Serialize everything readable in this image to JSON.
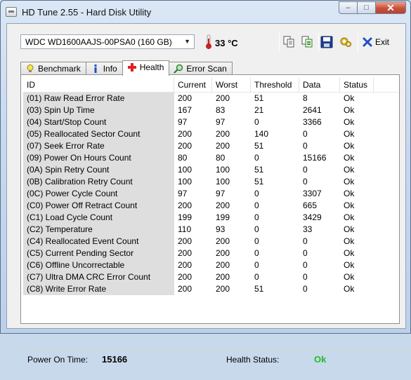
{
  "window": {
    "title": "HD Tune 2.55 - Hard Disk Utility",
    "buttons": {
      "minimize": "–",
      "maximize": "□",
      "close": "✕"
    }
  },
  "toolbar": {
    "drive": "WDC WD1600AAJS-00PSA0 (160 GB)",
    "temperature": "33 °C",
    "exit_label": "Exit",
    "icons": [
      "copy-icon",
      "copy-all-icon",
      "save-icon",
      "options-icon",
      "exit-icon"
    ]
  },
  "tabs": [
    {
      "label": "Benchmark",
      "icon": "lightbulb-icon",
      "active": false
    },
    {
      "label": "Info",
      "icon": "info-icon",
      "active": false
    },
    {
      "label": "Health",
      "icon": "health-cross-icon",
      "active": true
    },
    {
      "label": "Error Scan",
      "icon": "magnifier-icon",
      "active": false
    }
  ],
  "table": {
    "headers": [
      "ID",
      "Current",
      "Worst",
      "Threshold",
      "Data",
      "Status"
    ],
    "rows": [
      [
        "(01) Raw Read Error Rate",
        "200",
        "200",
        "51",
        "8",
        "Ok"
      ],
      [
        "(03) Spin Up Time",
        "167",
        "83",
        "21",
        "2641",
        "Ok"
      ],
      [
        "(04) Start/Stop Count",
        "97",
        "97",
        "0",
        "3366",
        "Ok"
      ],
      [
        "(05) Reallocated Sector Count",
        "200",
        "200",
        "140",
        "0",
        "Ok"
      ],
      [
        "(07) Seek Error Rate",
        "200",
        "200",
        "51",
        "0",
        "Ok"
      ],
      [
        "(09) Power On Hours Count",
        "80",
        "80",
        "0",
        "15166",
        "Ok"
      ],
      [
        "(0A) Spin Retry Count",
        "100",
        "100",
        "51",
        "0",
        "Ok"
      ],
      [
        "(0B) Calibration Retry Count",
        "100",
        "100",
        "51",
        "0",
        "Ok"
      ],
      [
        "(0C) Power Cycle Count",
        "97",
        "97",
        "0",
        "3307",
        "Ok"
      ],
      [
        "(C0) Power Off Retract Count",
        "200",
        "200",
        "0",
        "665",
        "Ok"
      ],
      [
        "(C1) Load Cycle Count",
        "199",
        "199",
        "0",
        "3429",
        "Ok"
      ],
      [
        "(C2) Temperature",
        "110",
        "93",
        "0",
        "33",
        "Ok"
      ],
      [
        "(C4) Reallocated Event Count",
        "200",
        "200",
        "0",
        "0",
        "Ok"
      ],
      [
        "(C5) Current Pending Sector",
        "200",
        "200",
        "0",
        "0",
        "Ok"
      ],
      [
        "(C6) Offline Uncorrectable",
        "200",
        "200",
        "0",
        "0",
        "Ok"
      ],
      [
        "(C7) Ultra DMA CRC Error Count",
        "200",
        "200",
        "0",
        "0",
        "Ok"
      ],
      [
        "(C8) Write Error Rate",
        "200",
        "200",
        "51",
        "0",
        "Ok"
      ]
    ]
  },
  "footer": {
    "power_on_label": "Power On Time:",
    "power_on_value": "15166",
    "health_label": "Health Status:",
    "health_value": "Ok"
  },
  "colors": {
    "health_ok": "#22bb22",
    "thermometer": "#d42020",
    "id_cell_bg": "#dedede"
  }
}
